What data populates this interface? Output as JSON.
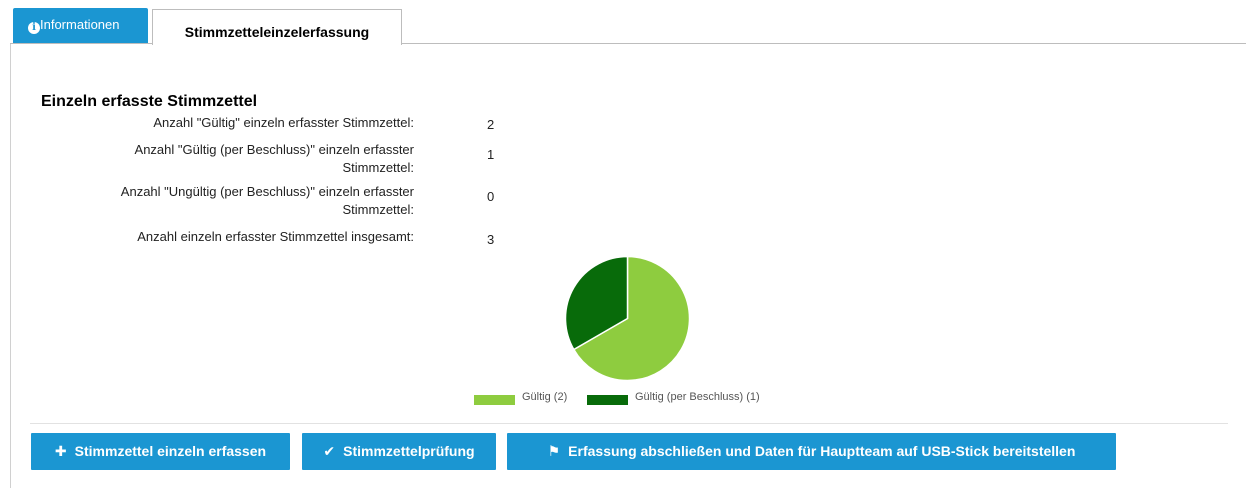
{
  "tabs": {
    "info_label": "Informationen",
    "active_label": "Stimmzetteleinzelerfassung"
  },
  "section": {
    "title": "Einzeln erfasste Stimmzettel",
    "rows": [
      {
        "label_l1": "Anzahl \"Gültig\" einzeln erfasster Stimmzettel:",
        "label_l2": "",
        "value": "2"
      },
      {
        "label_l1": "Anzahl \"Gültig (per Beschluss)\" einzeln erfasster",
        "label_l2": "Stimmzettel:",
        "value": "1"
      },
      {
        "label_l1": "Anzahl \"Ungültig (per Beschluss)\" einzeln erfasster",
        "label_l2": "Stimmzettel:",
        "value": "0"
      },
      {
        "label_l1": "Anzahl einzeln erfasster Stimmzettel insgesamt:",
        "label_l2": "",
        "value": "3"
      }
    ]
  },
  "chart_data": {
    "type": "pie",
    "slices": [
      {
        "label": "Gültig (2)",
        "value": 2,
        "color": "#8ecc3f"
      },
      {
        "label": "Gültig (per Beschluss) (1)",
        "value": 1,
        "color": "#086b0a"
      }
    ],
    "legend_position": "bottom"
  },
  "buttons": {
    "add_label": "Stimmzettel einzeln erfassen",
    "check_label": "Stimmzettelprüfung",
    "finish_label": "Erfassung abschließen und Daten für Hauptteam auf USB-Stick bereitstellen"
  },
  "icons": {
    "info": "info-circle-icon",
    "add": "plus-icon",
    "check": "check-icon",
    "finish": "flag-icon"
  },
  "colors": {
    "accent": "#1b96d2"
  }
}
